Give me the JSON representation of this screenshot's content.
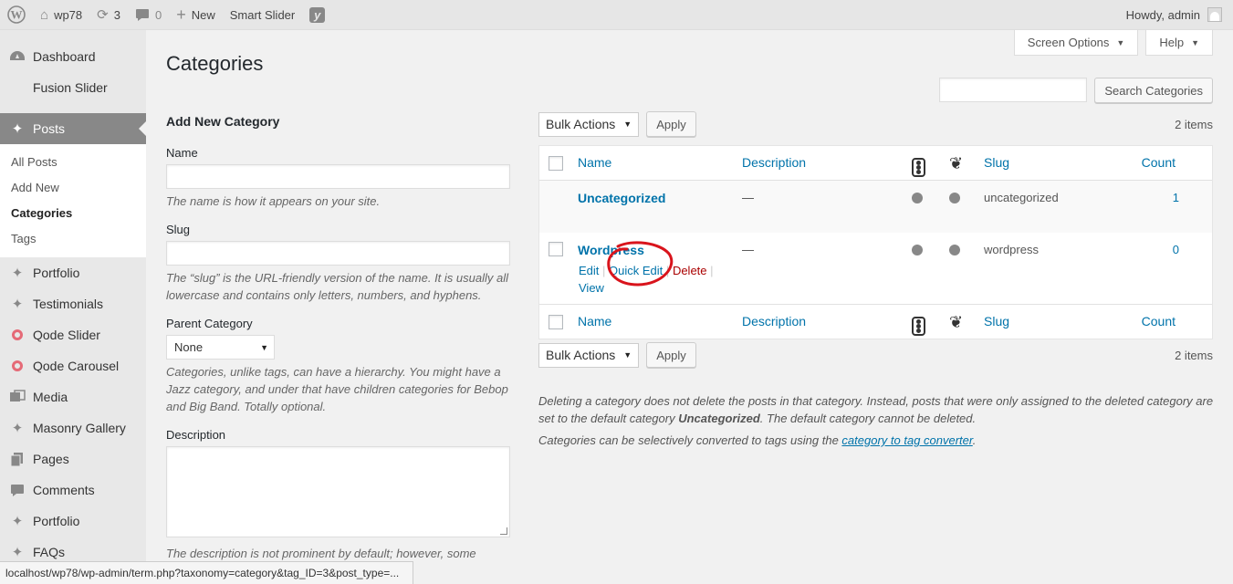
{
  "adminbar": {
    "site_name": "wp78",
    "updates_count": "3",
    "comments_count": "0",
    "new_label": "New",
    "smart_slider_label": "Smart Slider",
    "yoast_label": "y",
    "howdy": "Howdy, admin"
  },
  "sidebar": {
    "dashboard": "Dashboard",
    "fusion_slider": "Fusion Slider",
    "posts": "Posts",
    "posts_sub": [
      "All Posts",
      "Add New",
      "Categories",
      "Tags"
    ],
    "portfolio": "Portfolio",
    "testimonials": "Testimonials",
    "qode_slider": "Qode Slider",
    "qode_carousel": "Qode Carousel",
    "media": "Media",
    "masonry_gallery": "Masonry Gallery",
    "pages": "Pages",
    "comments": "Comments",
    "portfolio2": "Portfolio",
    "faqs": "FAQs"
  },
  "header": {
    "title": "Categories",
    "screen_options": "Screen Options",
    "help": "Help",
    "search_button": "Search Categories"
  },
  "form": {
    "heading": "Add New Category",
    "name_label": "Name",
    "name_help": "The name is how it appears on your site.",
    "slug_label": "Slug",
    "slug_help": "The “slug” is the URL-friendly version of the name. It is usually all lowercase and contains only letters, numbers, and hyphens.",
    "parent_label": "Parent Category",
    "parent_value": "None",
    "parent_help": "Categories, unlike tags, can have a hierarchy. You might have a Jazz category, and under that have children categories for Bebop and Big Band. Totally optional.",
    "description_label": "Description",
    "description_help": "The description is not prominent by default; however, some themes"
  },
  "table": {
    "bulk_actions": "Bulk Actions",
    "apply": "Apply",
    "items_count": "2 items",
    "columns": {
      "name": "Name",
      "description": "Description",
      "slug": "Slug",
      "count": "Count"
    },
    "rows": [
      {
        "name": "Uncategorized",
        "description": "—",
        "slug": "uncategorized",
        "count": "1"
      },
      {
        "name": "Wordpress",
        "description": "—",
        "slug": "wordpress",
        "count": "0"
      }
    ],
    "row_actions": {
      "edit": "Edit",
      "sep": "|",
      "quick_edit": "Quick Edit",
      "delete": "Delete",
      "view": "View"
    },
    "annotation_color": "#d9141c"
  },
  "notes": {
    "p1_before": "Deleting a category does not delete the posts in that category. Instead, posts that were only assigned to the deleted category are set to the default category ",
    "p1_bold": "Uncategorized",
    "p1_after": ". The default category cannot be deleted.",
    "p2_before": "Categories can be selectively converted to tags using the ",
    "p2_link": "category to tag converter",
    "p2_after": "."
  },
  "statusbar": {
    "url": "localhost/wp78/wp-admin/term.php?taxonomy=category&tag_ID=3&post_type=..."
  }
}
